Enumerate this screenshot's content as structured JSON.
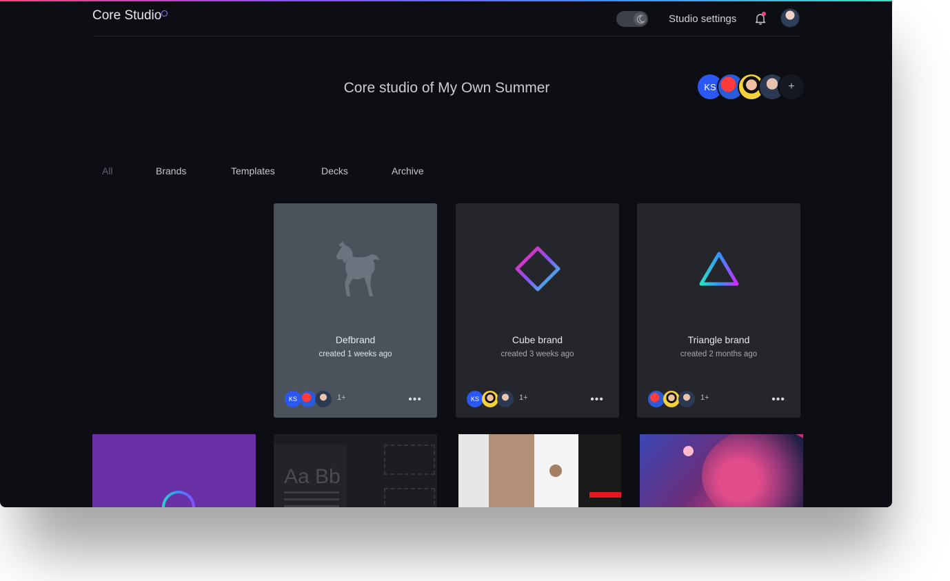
{
  "header": {
    "logo": "Core Studio",
    "settings_label": "Studio settings"
  },
  "studio": {
    "title": "Core studio of My Own Summer",
    "members": [
      {
        "label": "KS"
      },
      {
        "label": ""
      },
      {
        "label": ""
      },
      {
        "label": ""
      }
    ],
    "add_label": "+"
  },
  "tabs": [
    {
      "label": "All",
      "active": true
    },
    {
      "label": "Brands"
    },
    {
      "label": "Templates"
    },
    {
      "label": "Decks"
    },
    {
      "label": "Archive"
    }
  ],
  "cards": [
    {
      "name": "Defbrand",
      "meta": "created 1 weeks ago",
      "extra": "1+",
      "first_member": "KS",
      "icon": "horse-icon"
    },
    {
      "name": "Cube brand",
      "meta": "created 3 weeks ago",
      "extra": "1+",
      "first_member": "KS",
      "icon": "diamond-icon"
    },
    {
      "name": "Triangle brand",
      "meta": "created 2 months ago",
      "extra": "1+",
      "first_member": "",
      "icon": "triangle-icon"
    }
  ],
  "tiles": {
    "typography_sample": "Aa Bb"
  },
  "colors": {
    "background": "#0d0e13",
    "card": "#24262b",
    "card_active": "#4b525b",
    "accent_blue": "#2b57f5",
    "notification": "#ff3d8b"
  }
}
